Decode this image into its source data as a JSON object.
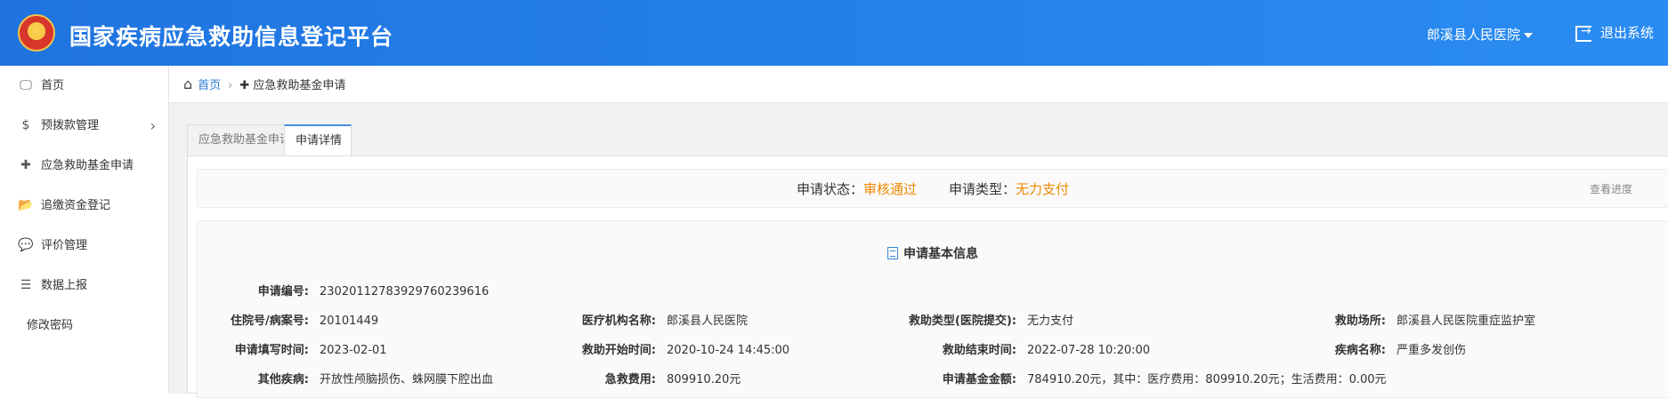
{
  "header": {
    "title": "国家疾病应急救助信息登记平台",
    "hospital": "郎溪县人民医院",
    "logout": "退出系统"
  },
  "sidebar": {
    "items": [
      {
        "label": "首页",
        "icon": "monitor-icon",
        "glyph": "🖵"
      },
      {
        "label": "预拨款管理",
        "icon": "dollar-icon",
        "glyph": "$"
      },
      {
        "label": "应急救助基金申请",
        "icon": "plus-icon",
        "glyph": "✚"
      },
      {
        "label": "追缴资金登记",
        "icon": "folder-icon",
        "glyph": "📂"
      },
      {
        "label": "评价管理",
        "icon": "comment-icon",
        "glyph": "💬"
      },
      {
        "label": "数据上报",
        "icon": "list-icon",
        "glyph": "☰"
      },
      {
        "label": "修改密码"
      }
    ]
  },
  "breadcrumb": {
    "home": "首页",
    "current": "应急救助基金申请"
  },
  "tabs": [
    {
      "label": "应急救助基金申请"
    },
    {
      "label": "申请详情"
    }
  ],
  "status": {
    "state_label": "申请状态：",
    "state_value": "审核通过",
    "type_label": "申请类型：",
    "type_value": "无力支付",
    "progress_link": "查看进度",
    "accent_color": "#f08a00"
  },
  "info": {
    "title": "申请基本信息",
    "fields": [
      {
        "label": "申请编号:",
        "value": "23020112783929760239616"
      },
      {
        "label": "住院号/病案号:",
        "value": "20101449"
      },
      {
        "label": "医疗机构名称:",
        "value": "郎溪县人民医院"
      },
      {
        "label": "救助类型(医院提交):",
        "value": "无力支付"
      },
      {
        "label": "救助场所:",
        "value": "郎溪县人民医院重症监护室"
      },
      {
        "label": "申请填写时间:",
        "value": "2023-02-01"
      },
      {
        "label": "救助开始时间:",
        "value": "2020-10-24 14:45:00"
      },
      {
        "label": "救助结束时间:",
        "value": "2022-07-28 10:20:00"
      },
      {
        "label": "疾病名称:",
        "value": "严重多发创伤"
      },
      {
        "label": "其他疾病:",
        "value": "开放性颅脑损伤、蛛网膜下腔出血"
      },
      {
        "label": "急救费用:",
        "value": "809910.20元"
      },
      {
        "label": "申请基金金额:",
        "value": "784910.20元，其中：医疗费用：809910.20元；生活费用：0.00元"
      }
    ]
  }
}
